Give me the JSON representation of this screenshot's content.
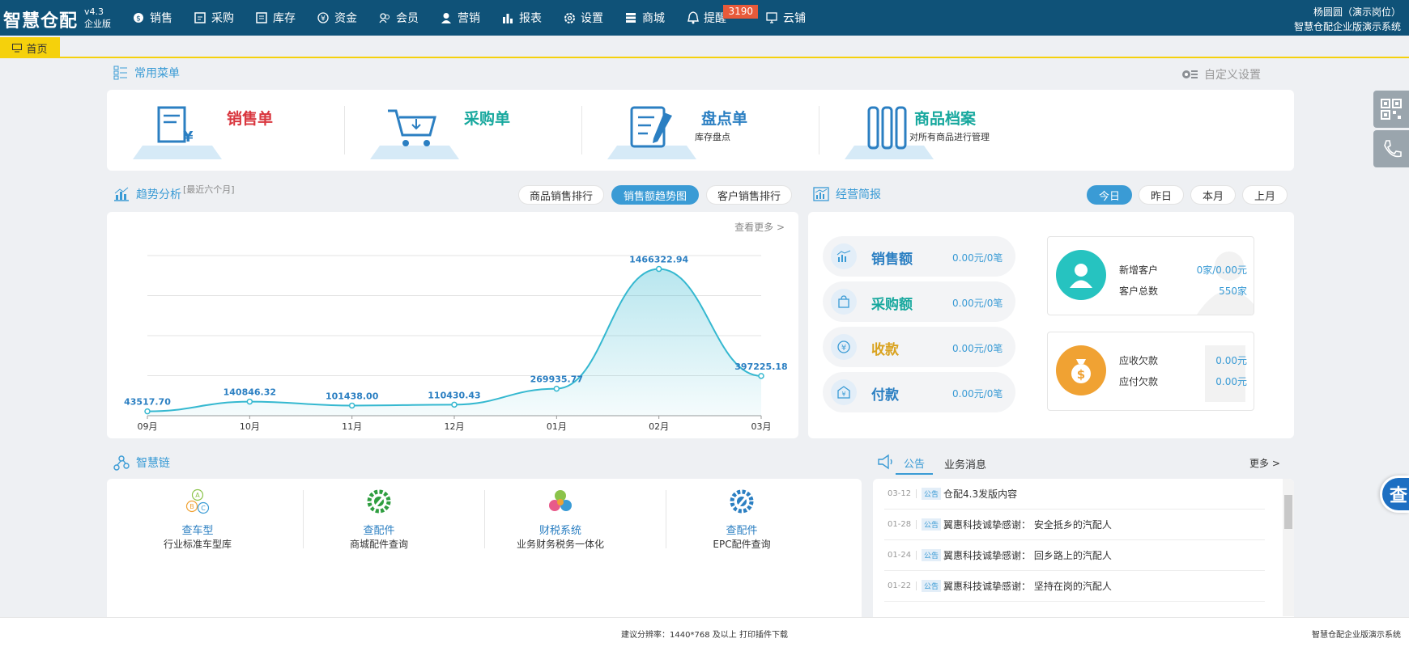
{
  "app": {
    "logo": "智慧仓配",
    "version": "v4.3",
    "edition": "企业版",
    "user_name": "杨圆圆（演示岗位）",
    "company": "智慧仓配企业版演示系统"
  },
  "nav": [
    {
      "label": "销售",
      "icon": "sales-icon"
    },
    {
      "label": "采购",
      "icon": "purchase-icon"
    },
    {
      "label": "库存",
      "icon": "inventory-icon"
    },
    {
      "label": "资金",
      "icon": "funds-icon"
    },
    {
      "label": "会员",
      "icon": "member-icon"
    },
    {
      "label": "营销",
      "icon": "marketing-icon"
    },
    {
      "label": "报表",
      "icon": "report-icon"
    },
    {
      "label": "设置",
      "icon": "gear-icon"
    },
    {
      "label": "商城",
      "icon": "mall-icon"
    },
    {
      "label": "提醒",
      "icon": "bell-icon",
      "badge": "3190"
    },
    {
      "label": "云铺",
      "icon": "cloud-shop-icon"
    }
  ],
  "tabs": {
    "home": "首页"
  },
  "common_menu": {
    "title": "常用菜单",
    "custom_settings": "自定义设置",
    "items": [
      {
        "title": "销售单",
        "desc": "",
        "color": "#d9363e"
      },
      {
        "title": "采购单",
        "desc": "",
        "color": "#18a89e"
      },
      {
        "title": "盘点单",
        "desc": "库存盘点",
        "color": "#2b7fc2"
      },
      {
        "title": "商品档案",
        "desc": "对所有商品进行管理",
        "color": "#18a89e"
      }
    ]
  },
  "trend": {
    "title": "趋势分析",
    "subtitle": "[最近六个月]",
    "tabs": [
      "商品销售排行",
      "销售额趋势图",
      "客户销售排行"
    ],
    "active_tab": 1,
    "view_more": "查看更多 >"
  },
  "chart_data": {
    "type": "area",
    "categories": [
      "09月",
      "10月",
      "11月",
      "12月",
      "01月",
      "02月",
      "03月"
    ],
    "values": [
      43517.7,
      140846.32,
      101438.0,
      110430.43,
      269935.77,
      1466322.94,
      397225.18
    ],
    "labels": [
      "43517.70",
      "140846.32",
      "101438.00",
      "110430.43",
      "269935.77",
      "1466322.94",
      "397225.18"
    ],
    "ylim": [
      0,
      1600000
    ],
    "grid": true,
    "color": "#35b8d0"
  },
  "report": {
    "title": "经营简报",
    "periods": [
      "今日",
      "昨日",
      "本月",
      "上月"
    ],
    "active_period": 0,
    "stats": [
      {
        "label": "销售额",
        "value": "0.00元/0笔",
        "color": "#2b7fc2"
      },
      {
        "label": "采购额",
        "value": "0.00元/0笔",
        "color": "#18a89e"
      },
      {
        "label": "收款",
        "value": "0.00元/0笔",
        "color": "#d9a21e"
      },
      {
        "label": "付款",
        "value": "0.00元/0笔",
        "color": "#2b7fc2"
      }
    ],
    "customers": {
      "new_label": "新增客户",
      "new_value": "0家/0.00元",
      "total_label": "客户总数",
      "total_value": "550家"
    },
    "debts": {
      "recv_label": "应收欠款",
      "recv_value": "0.00元",
      "pay_label": "应付欠款",
      "pay_value": "0.00元"
    }
  },
  "chain": {
    "title": "智慧链",
    "items": [
      {
        "title": "查车型",
        "desc": "行业标准车型库"
      },
      {
        "title": "查配件",
        "desc": "商城配件查询"
      },
      {
        "title": "财税系统",
        "desc": "业务财务税务一体化"
      },
      {
        "title": "查配件",
        "desc": "EPC配件查询"
      }
    ]
  },
  "announce": {
    "tabs": [
      "公告",
      "业务消息"
    ],
    "more": "更多 >",
    "tag": "公告",
    "items": [
      {
        "date": "03-12",
        "text": "仓配4.3发版内容"
      },
      {
        "date": "01-28",
        "text": "翼惠科技诚挚感谢：  安全抵乡的汽配人"
      },
      {
        "date": "01-24",
        "text": "翼惠科技诚挚感谢：  回乡路上的汽配人"
      },
      {
        "date": "01-22",
        "text": "翼惠科技诚挚感谢：  坚持在岗的汽配人"
      }
    ]
  },
  "side": {
    "search_label": "查"
  },
  "footer": {
    "center": "建议分辨率：1440*768 及以上   打印插件下载",
    "right": "智慧仓配企业版演示系统"
  }
}
